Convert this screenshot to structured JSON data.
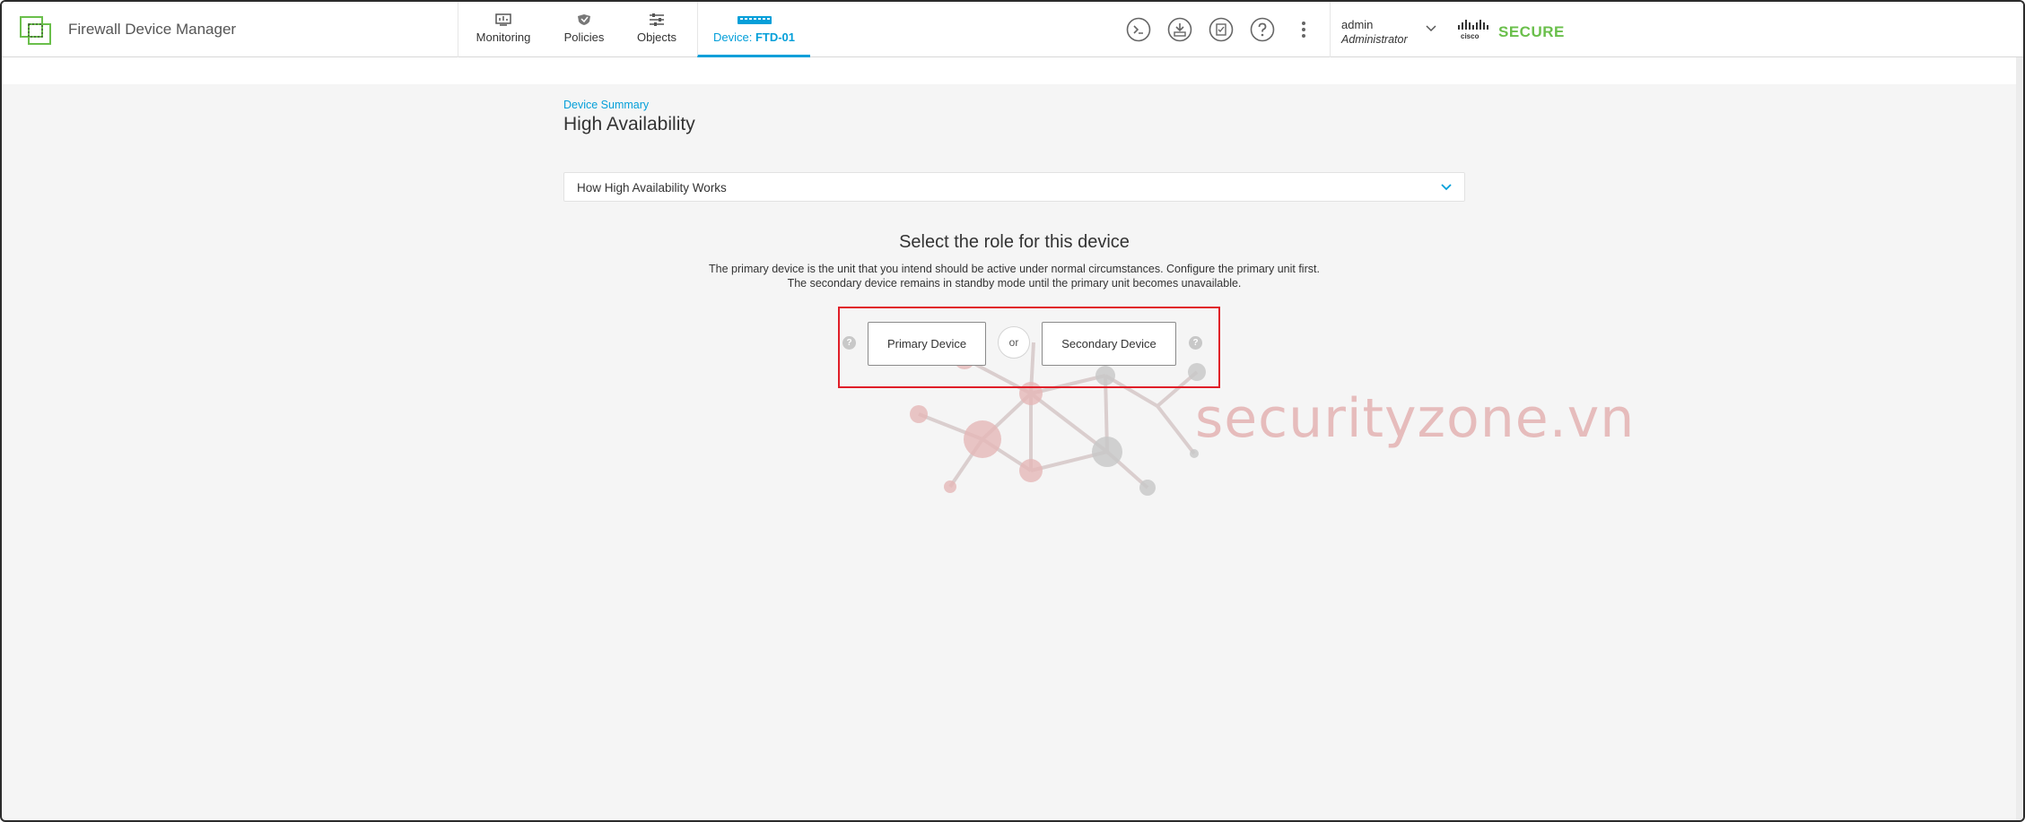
{
  "app": {
    "title": "Firewall Device Manager"
  },
  "nav": {
    "items": [
      {
        "label": "Monitoring",
        "icon": "monitor-icon"
      },
      {
        "label": "Policies",
        "icon": "shield-icon"
      },
      {
        "label": "Objects",
        "icon": "sliders-icon"
      }
    ],
    "device_prefix": "Device: ",
    "device_name": "FTD-01",
    "active": "Device: FTD-01"
  },
  "user": {
    "name": "admin",
    "role": "Administrator"
  },
  "brand": {
    "secure": "SECURE",
    "accent": "#049fd9",
    "green": "#6abf4b"
  },
  "page": {
    "breadcrumb": "Device Summary",
    "title": "High Availability",
    "accordion_label": "How High Availability Works",
    "role_heading": "Select the role for this device",
    "role_desc_line1": "The primary device is the unit that you intend should be active under normal circumstances. Configure the primary unit first.",
    "role_desc_line2": "The secondary device remains in standby mode until the primary unit becomes unavailable.",
    "primary_button": "Primary Device",
    "or_label": "or",
    "secondary_button": "Secondary Device",
    "help_glyph": "?"
  },
  "watermark": {
    "text": "securityzone.vn"
  },
  "highlight_color": "#e01e28"
}
